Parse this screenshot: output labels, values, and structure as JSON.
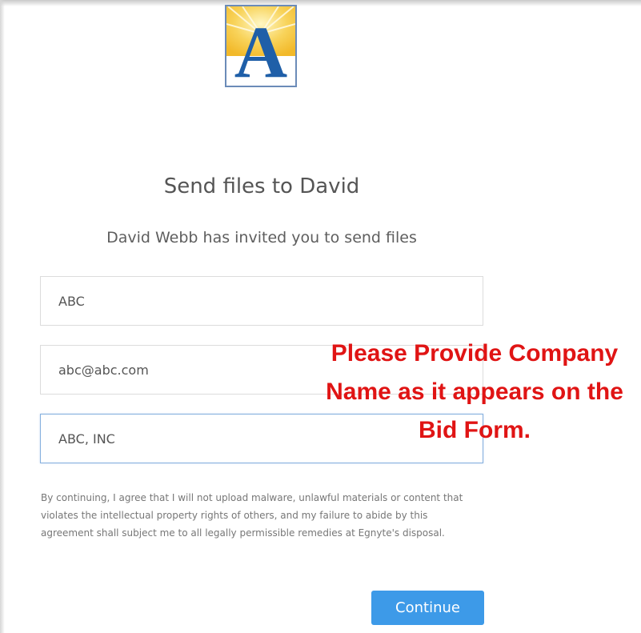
{
  "header": {
    "logo_letter": "A"
  },
  "main": {
    "title": "Send files to David",
    "subtitle": "David Webb has invited you to send files",
    "fields": [
      {
        "value": "ABC"
      },
      {
        "value": "abc@abc.com"
      },
      {
        "value": "ABC, INC"
      }
    ],
    "disclaimer": "By continuing, I agree that I will not upload malware, unlawful materials or content that violates the intellectual property rights of others, and my failure to abide by this agreement shall subject me to all legally permissible remedies at Egnyte's disposal.",
    "continue_label": "Continue"
  },
  "annotation": {
    "text": "Please Provide Company Name as it appears on the Bid Form."
  },
  "colors": {
    "button": "#3d9ae8",
    "annotation": "#e01414",
    "logo_blue": "#1f5fa8",
    "logo_sun": "#f6c838"
  }
}
